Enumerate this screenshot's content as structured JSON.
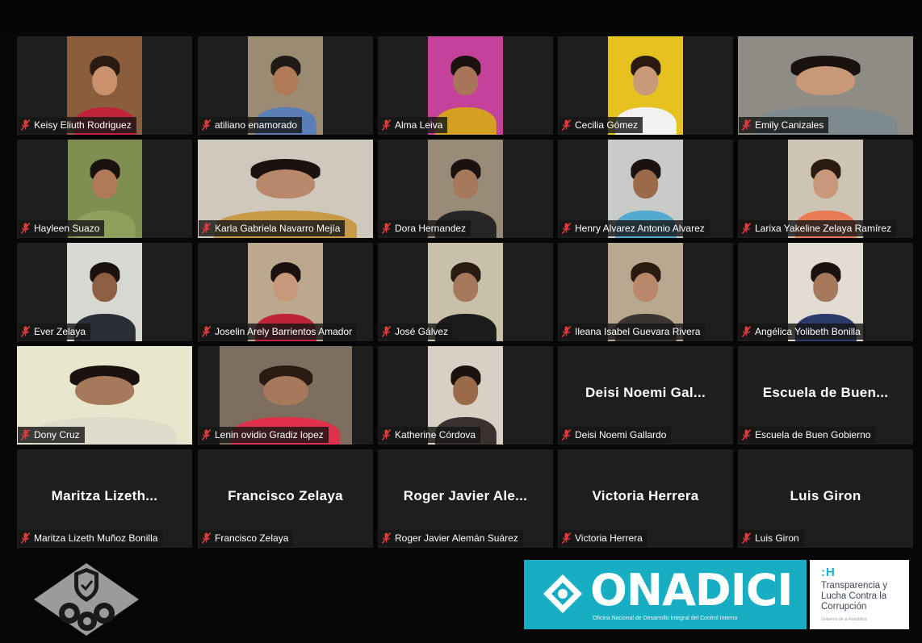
{
  "meeting": {
    "rows": [
      [
        {
          "name": "Keisy Eliuth Rodriguez",
          "video": true,
          "muted": true,
          "w": "b",
          "bg": "#8a5d3c",
          "skin": "#c9916c",
          "hair": "#2a1a12",
          "shirt": "#c0233a"
        },
        {
          "name": "atiliano enamorado",
          "video": true,
          "muted": true,
          "w": "b",
          "bg": "#9b8b73",
          "skin": "#b07a58",
          "hair": "#1f1a16",
          "shirt": "#5a7fb8"
        },
        {
          "name": "Alma Leiva",
          "video": true,
          "muted": true,
          "w": "b",
          "bg": "#c4429a",
          "skin": "#a8755a",
          "hair": "#1a120e",
          "shirt": "#d4a021"
        },
        {
          "name": "Cecilia Gómez",
          "video": true,
          "muted": true,
          "w": "b",
          "bg": "#e6c220",
          "skin": "#c89a7a",
          "hair": "#2a1a12",
          "shirt": "#f2f2f2"
        },
        {
          "name": "Emily Canizales",
          "video": true,
          "muted": true,
          "w": "f",
          "bg": "#8e8c84",
          "skin": "#c99878",
          "hair": "#1a120e",
          "shirt": "#7d8a90"
        }
      ],
      [
        {
          "name": "Hayleen Suazo",
          "video": true,
          "muted": true,
          "w": "a",
          "bg": "#7f8f52",
          "skin": "#b07a58",
          "hair": "#1a120e",
          "shirt": "#8fa05c"
        },
        {
          "name": "Karla Gabriela Navarro Mejía",
          "video": true,
          "muted": true,
          "w": "f",
          "bg": "#cfc8bd",
          "skin": "#b9876a",
          "hair": "#1a120e",
          "shirt": "#c89a48"
        },
        {
          "name": "Dora Hernandez",
          "video": true,
          "muted": true,
          "w": "b",
          "bg": "#9a8a78",
          "skin": "#a6785c",
          "hair": "#1a120e",
          "shirt": "#262626"
        },
        {
          "name": "Henry Alvarez Antonio Alvarez",
          "video": true,
          "muted": true,
          "w": "b",
          "bg": "#c9cbc8",
          "skin": "#9a6a4a",
          "hair": "#1a120e",
          "shirt": "#52a9cf"
        },
        {
          "name": "Larixa Yakeline Zelaya Ramírez",
          "video": true,
          "muted": true,
          "w": "b",
          "bg": "#cec4b4",
          "skin": "#c8987a",
          "hair": "#2a1a12",
          "shirt": "#e87a54"
        }
      ],
      [
        {
          "name": "Ever Zelaya",
          "video": true,
          "muted": true,
          "w": "b",
          "bg": "#d8d8d2",
          "skin": "#8e5e40",
          "hair": "#1a120e",
          "shirt": "#2a2e36"
        },
        {
          "name": "Joselin Arely Barrientos Amador",
          "video": true,
          "muted": true,
          "w": "b",
          "bg": "#bba88e",
          "skin": "#c8987a",
          "hair": "#1a120e",
          "shirt": "#c02238"
        },
        {
          "name": "José Gálvez",
          "video": true,
          "muted": true,
          "w": "b",
          "bg": "#c8c0a8",
          "skin": "#a6785c",
          "hair": "#2a1a12",
          "shirt": "#1c1c1c"
        },
        {
          "name": "Ileana Isabel Guevara Rivera",
          "video": true,
          "muted": true,
          "w": "b",
          "bg": "#b8a890",
          "skin": "#b9876a",
          "hair": "#2a1a12",
          "shirt": "#3a3430"
        },
        {
          "name": "Angélica Yolibeth Bonilla",
          "video": true,
          "muted": true,
          "w": "b",
          "bg": "#e2dcd2",
          "skin": "#a6785c",
          "hair": "#1a120e",
          "shirt": "#2a3a6a"
        }
      ],
      [
        {
          "name": "Dony Cruz",
          "video": true,
          "muted": true,
          "w": "f",
          "bg": "#e8e6cc",
          "skin": "#a6785c",
          "hair": "#1a120e",
          "shirt": "#e0dccc"
        },
        {
          "name": "Lenin ovidio Gradiz lopez",
          "video": true,
          "muted": true,
          "w": "c",
          "bg": "#7d6e60",
          "skin": "#a6785c",
          "hair": "#2a1a12",
          "shirt": "#e0304a"
        },
        {
          "name": "Katherine Córdova",
          "video": true,
          "muted": true,
          "w": "b",
          "bg": "#d8d0c4",
          "skin": "#9a6a4a",
          "hair": "#1a120e",
          "shirt": "#3a3030"
        },
        {
          "name": "Deisi Noemi Gallardo",
          "video": false,
          "muted": true,
          "title": "Deisi Noemi Gal..."
        },
        {
          "name": "Escuela de Buen Gobierno",
          "video": false,
          "muted": true,
          "title": "Escuela de Buen..."
        }
      ],
      [
        {
          "name": "Maritza Lizeth Muñoz Bonilla",
          "video": false,
          "muted": true,
          "title": "Maritza  Lizeth..."
        },
        {
          "name": "Francisco Zelaya",
          "video": false,
          "muted": true,
          "title": "Francisco Zelaya"
        },
        {
          "name": "Roger Javier Alemán Suárez",
          "video": false,
          "muted": true,
          "title": "Roger  Javier  Ale..."
        },
        {
          "name": "Victoria Herrera",
          "video": false,
          "muted": true,
          "title": "Victoria Herrera"
        },
        {
          "name": "Luis Giron",
          "video": false,
          "muted": true,
          "title": "Luis Giron"
        }
      ]
    ]
  },
  "colors": {
    "background": "#060606",
    "tile": "#1e1e1e",
    "muted_icon": "#e23a3a",
    "onadici_blue": "#17aec4"
  },
  "icons": {
    "muted": "microphone-muted-icon",
    "left_logo": "shield-gears-logo",
    "onadici_emblem": "diamond-emblem"
  },
  "branding": {
    "onadici_title": "ONADICI",
    "onadici_subtitle": "Oficina Nacional de Desarrollo Integral del Control Interno",
    "tr_h": ":H",
    "tr_title": "Transparencia y Lucha Contra la Corrupción",
    "tr_sub": "Gobierno de la República"
  }
}
